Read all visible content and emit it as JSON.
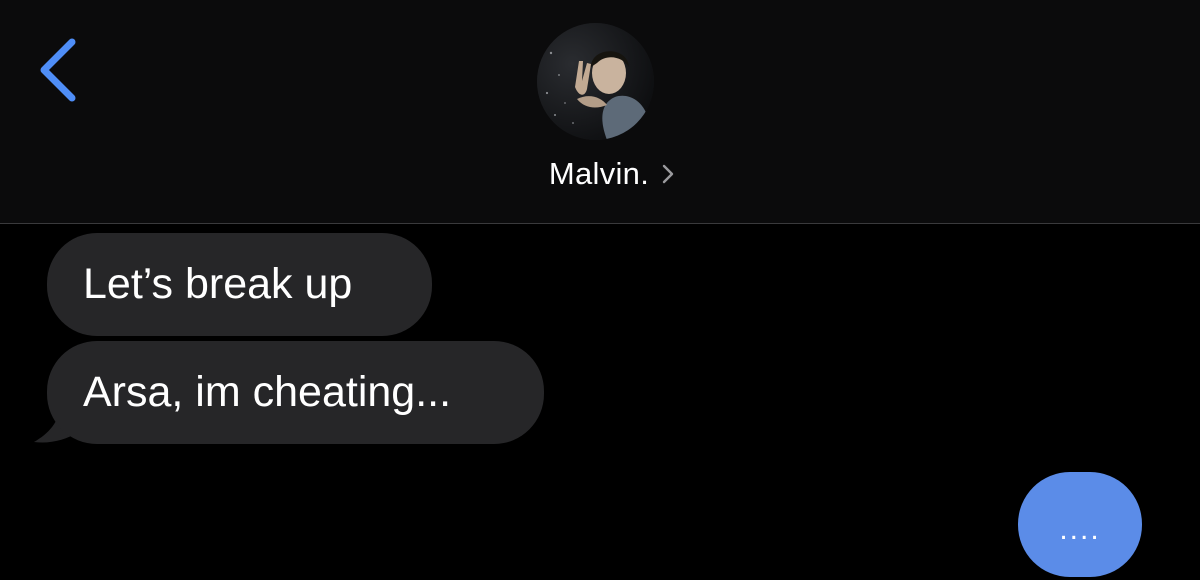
{
  "header": {
    "contact_name": "Malvin.",
    "back_icon": "chevron-left-icon",
    "details_icon": "chevron-right-icon",
    "accent_color": "#4f8ef7"
  },
  "messages": [
    {
      "direction": "incoming",
      "text": "Let’s break up"
    },
    {
      "direction": "incoming",
      "text": "Arsa, im cheating..."
    }
  ],
  "typing_indicator": {
    "text": "....",
    "color": "#5b8ce8"
  }
}
